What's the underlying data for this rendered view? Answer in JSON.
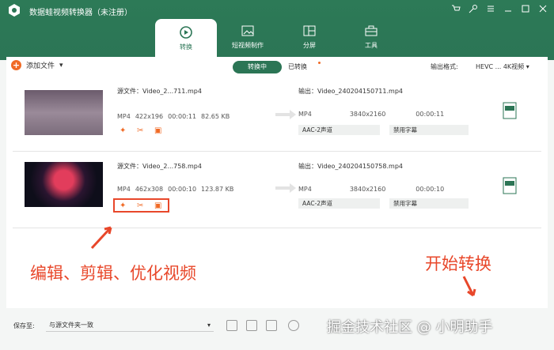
{
  "window": {
    "title": "数据蛙视频转换器（未注册）"
  },
  "tabs": [
    {
      "label": "转换"
    },
    {
      "label": "短视频制作"
    },
    {
      "label": "分屏"
    },
    {
      "label": "工具"
    }
  ],
  "toolbar": {
    "add_label": "添加文件",
    "converting_label": "转换中",
    "converted_label": "已转换",
    "format_label": "输出格式:",
    "format_value": "HEVC ... 4K视频"
  },
  "files": [
    {
      "source": "源文件：Video_2...711.mp4",
      "format": "MP4",
      "resolution": "422x196",
      "duration": "00:00:11",
      "size": "82.65 KB",
      "output": "输出：Video_240204150711.mp4",
      "out_format": "MP4",
      "out_resolution": "3840x2160",
      "out_duration": "00:00:11",
      "audio": "AAC-2声道",
      "subtitle": "禁用字幕"
    },
    {
      "source": "源文件：Video_2...758.mp4",
      "format": "MP4",
      "resolution": "462x308",
      "duration": "00:00:10",
      "size": "123.87 KB",
      "output": "输出：Video_240204150758.mp4",
      "out_format": "MP4",
      "out_resolution": "3840x2160",
      "out_duration": "00:00:10",
      "audio": "AAC-2声道",
      "subtitle": "禁用字幕"
    }
  ],
  "annotations": {
    "edit_text": "编辑、剪辑、优化视频",
    "start_text": "开始转换"
  },
  "bottom": {
    "save_label": "保存至:",
    "save_value": "与源文件夹一致",
    "watermark": "掘金技术社区 @ 小明助手"
  },
  "colors": {
    "brand": "#2b7555",
    "accent": "#f06a25",
    "annotation": "#e8472a"
  }
}
